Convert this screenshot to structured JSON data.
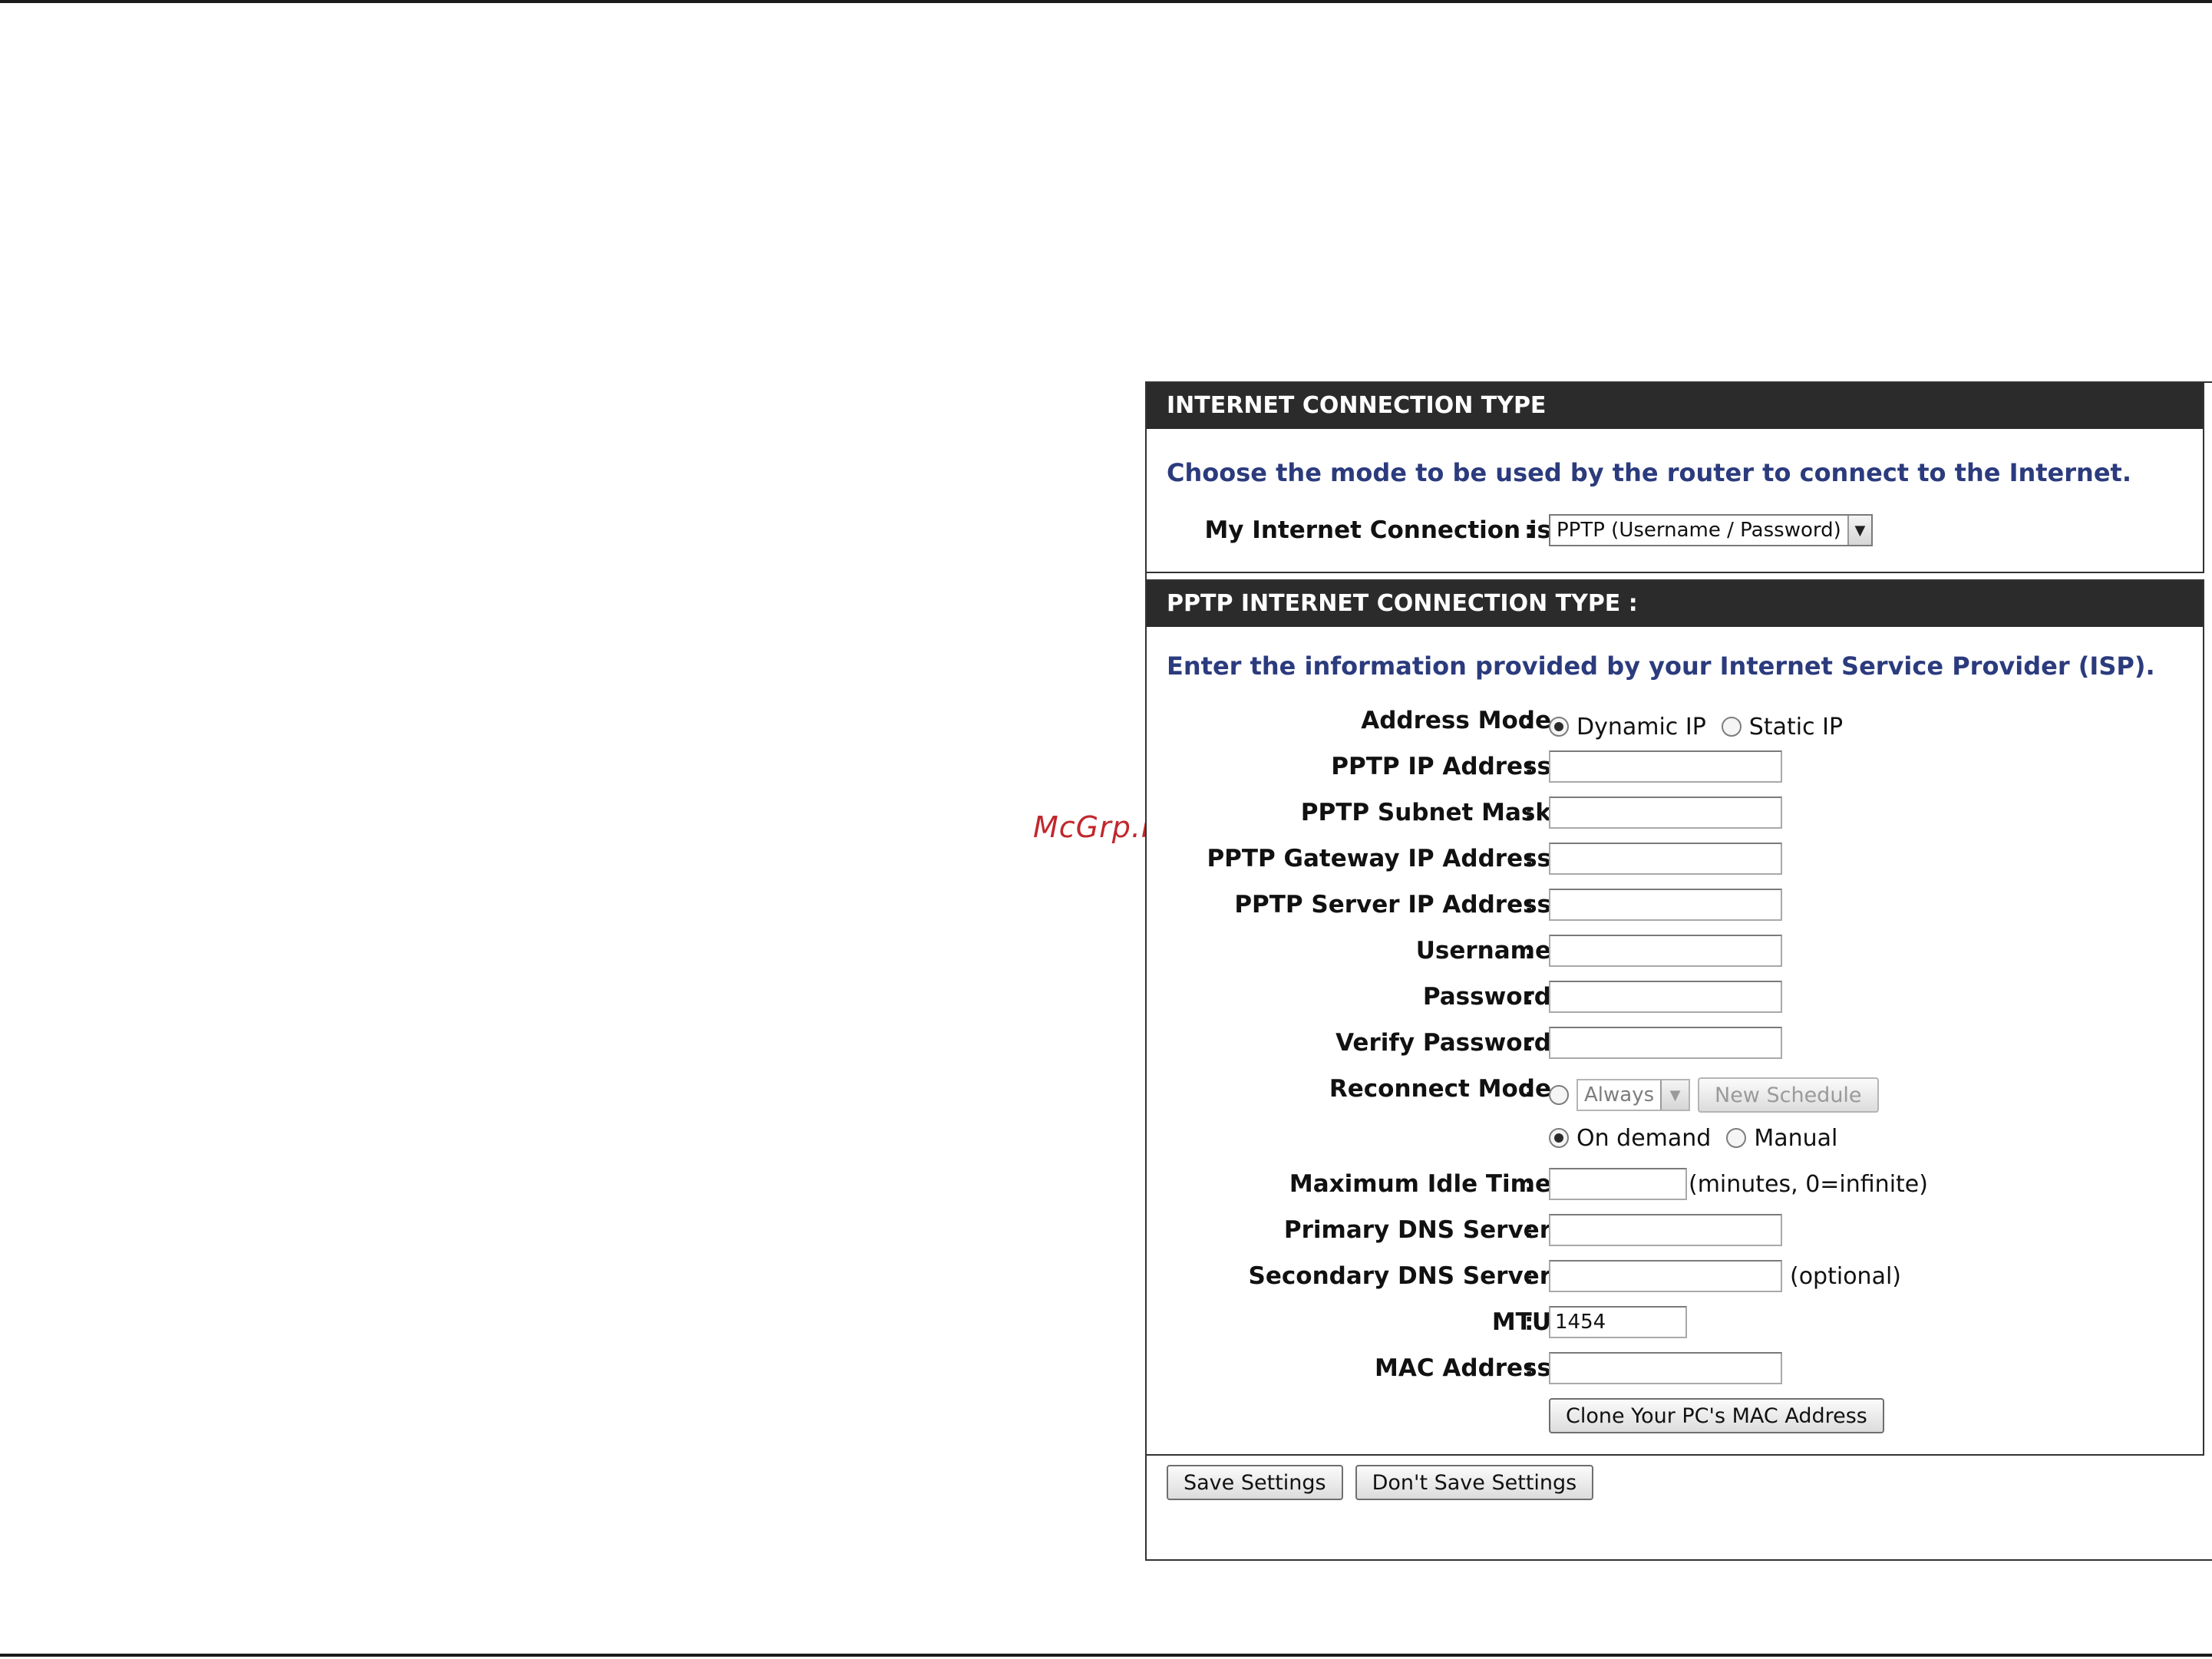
{
  "watermark": "McGrp.Ru",
  "section1": {
    "title": "INTERNET CONNECTION TYPE",
    "intro": "Choose the mode to be used by the router to connect to the Internet.",
    "connection_label": "My Internet Connection is",
    "connection_value": "PPTP (Username / Password)"
  },
  "section2": {
    "title": "PPTP INTERNET CONNECTION TYPE :",
    "intro": "Enter the information provided by your Internet Service Provider (ISP).",
    "address_mode": {
      "label": "Address Mode",
      "options": [
        "Dynamic IP",
        "Static IP"
      ],
      "selected": "Dynamic IP"
    },
    "fields": {
      "pptp_ip": {
        "label": "PPTP IP Address",
        "value": ""
      },
      "pptp_subnet": {
        "label": "PPTP Subnet Mask",
        "value": ""
      },
      "pptp_gateway": {
        "label": "PPTP Gateway IP Address",
        "value": ""
      },
      "pptp_server": {
        "label": "PPTP Server IP Address",
        "value": ""
      },
      "username": {
        "label": "Username",
        "value": ""
      },
      "password": {
        "label": "Password",
        "value": ""
      },
      "verify_password": {
        "label": "Verify Password",
        "value": ""
      }
    },
    "reconnect": {
      "label": "Reconnect Mode",
      "schedule_value": "Always",
      "new_schedule": "New Schedule",
      "on_demand": "On demand",
      "manual": "Manual",
      "selected": "On demand"
    },
    "idle": {
      "label": "Maximum Idle Time",
      "value": "",
      "note": "(minutes, 0=infinite)"
    },
    "dns_primary": {
      "label": "Primary DNS Server",
      "value": ""
    },
    "dns_secondary": {
      "label": "Secondary DNS Server",
      "value": "",
      "note": "(optional)"
    },
    "mtu": {
      "label": "MTU",
      "value": "1454"
    },
    "mac": {
      "label": "MAC Address",
      "value": ""
    },
    "clone_button": "Clone Your PC's MAC Address"
  },
  "actions": {
    "save": "Save Settings",
    "dont_save": "Don't Save Settings"
  }
}
